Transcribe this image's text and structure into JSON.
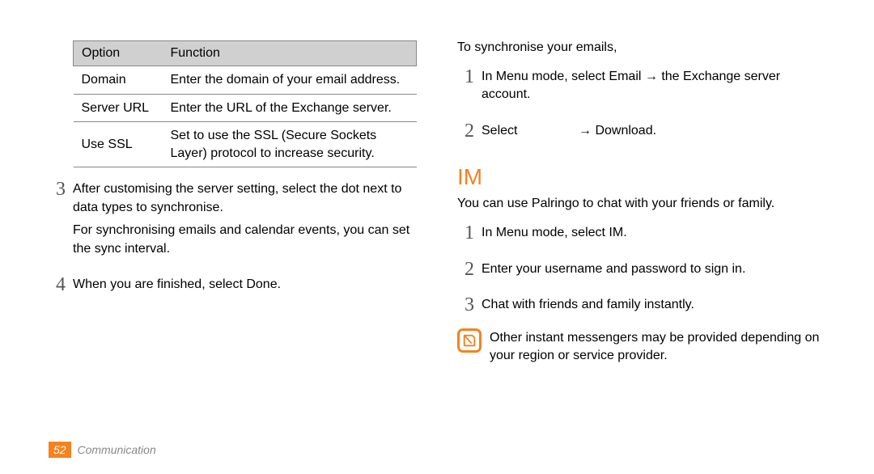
{
  "table": {
    "headers": {
      "option": "Option",
      "function": "Function"
    },
    "rows": [
      {
        "option": "Domain",
        "function": "Enter the domain of your email address."
      },
      {
        "option": "Server URL",
        "function": "Enter the URL of the Exchange server."
      },
      {
        "option": "Use SSL",
        "function": "Set to use the SSL (Secure Sockets Layer) protocol to increase security."
      }
    ]
  },
  "left_steps": {
    "s3": {
      "num": "3",
      "p1": "After customising the server setting, select the dot next to data types to synchronise.",
      "p2": "For synchronising emails and calendar events, you can set the sync interval."
    },
    "s4": {
      "num": "4",
      "p1_a": "When you are finished, select ",
      "p1_b": "Done",
      "p1_c": "."
    }
  },
  "sync": {
    "lead": "To synchronise your emails,",
    "s1": {
      "num": "1",
      "a": "In Menu mode, select ",
      "b": "Email",
      "c": " → the Exchange server account."
    },
    "s2": {
      "num": "2",
      "a": "Select",
      "b": "→ Download."
    }
  },
  "im": {
    "heading": "IM",
    "desc": "You can use Palringo to chat with your friends or family.",
    "s1": {
      "num": "1",
      "a": "In Menu mode, select ",
      "b": "IM",
      "c": "."
    },
    "s2": {
      "num": "2",
      "a": "Enter your username and password to sign in."
    },
    "s3": {
      "num": "3",
      "a": "Chat with friends and family instantly."
    },
    "note": "Other instant messengers may be provided depending on your region or service provider."
  },
  "footer": {
    "page": "52",
    "section": "Communication"
  }
}
